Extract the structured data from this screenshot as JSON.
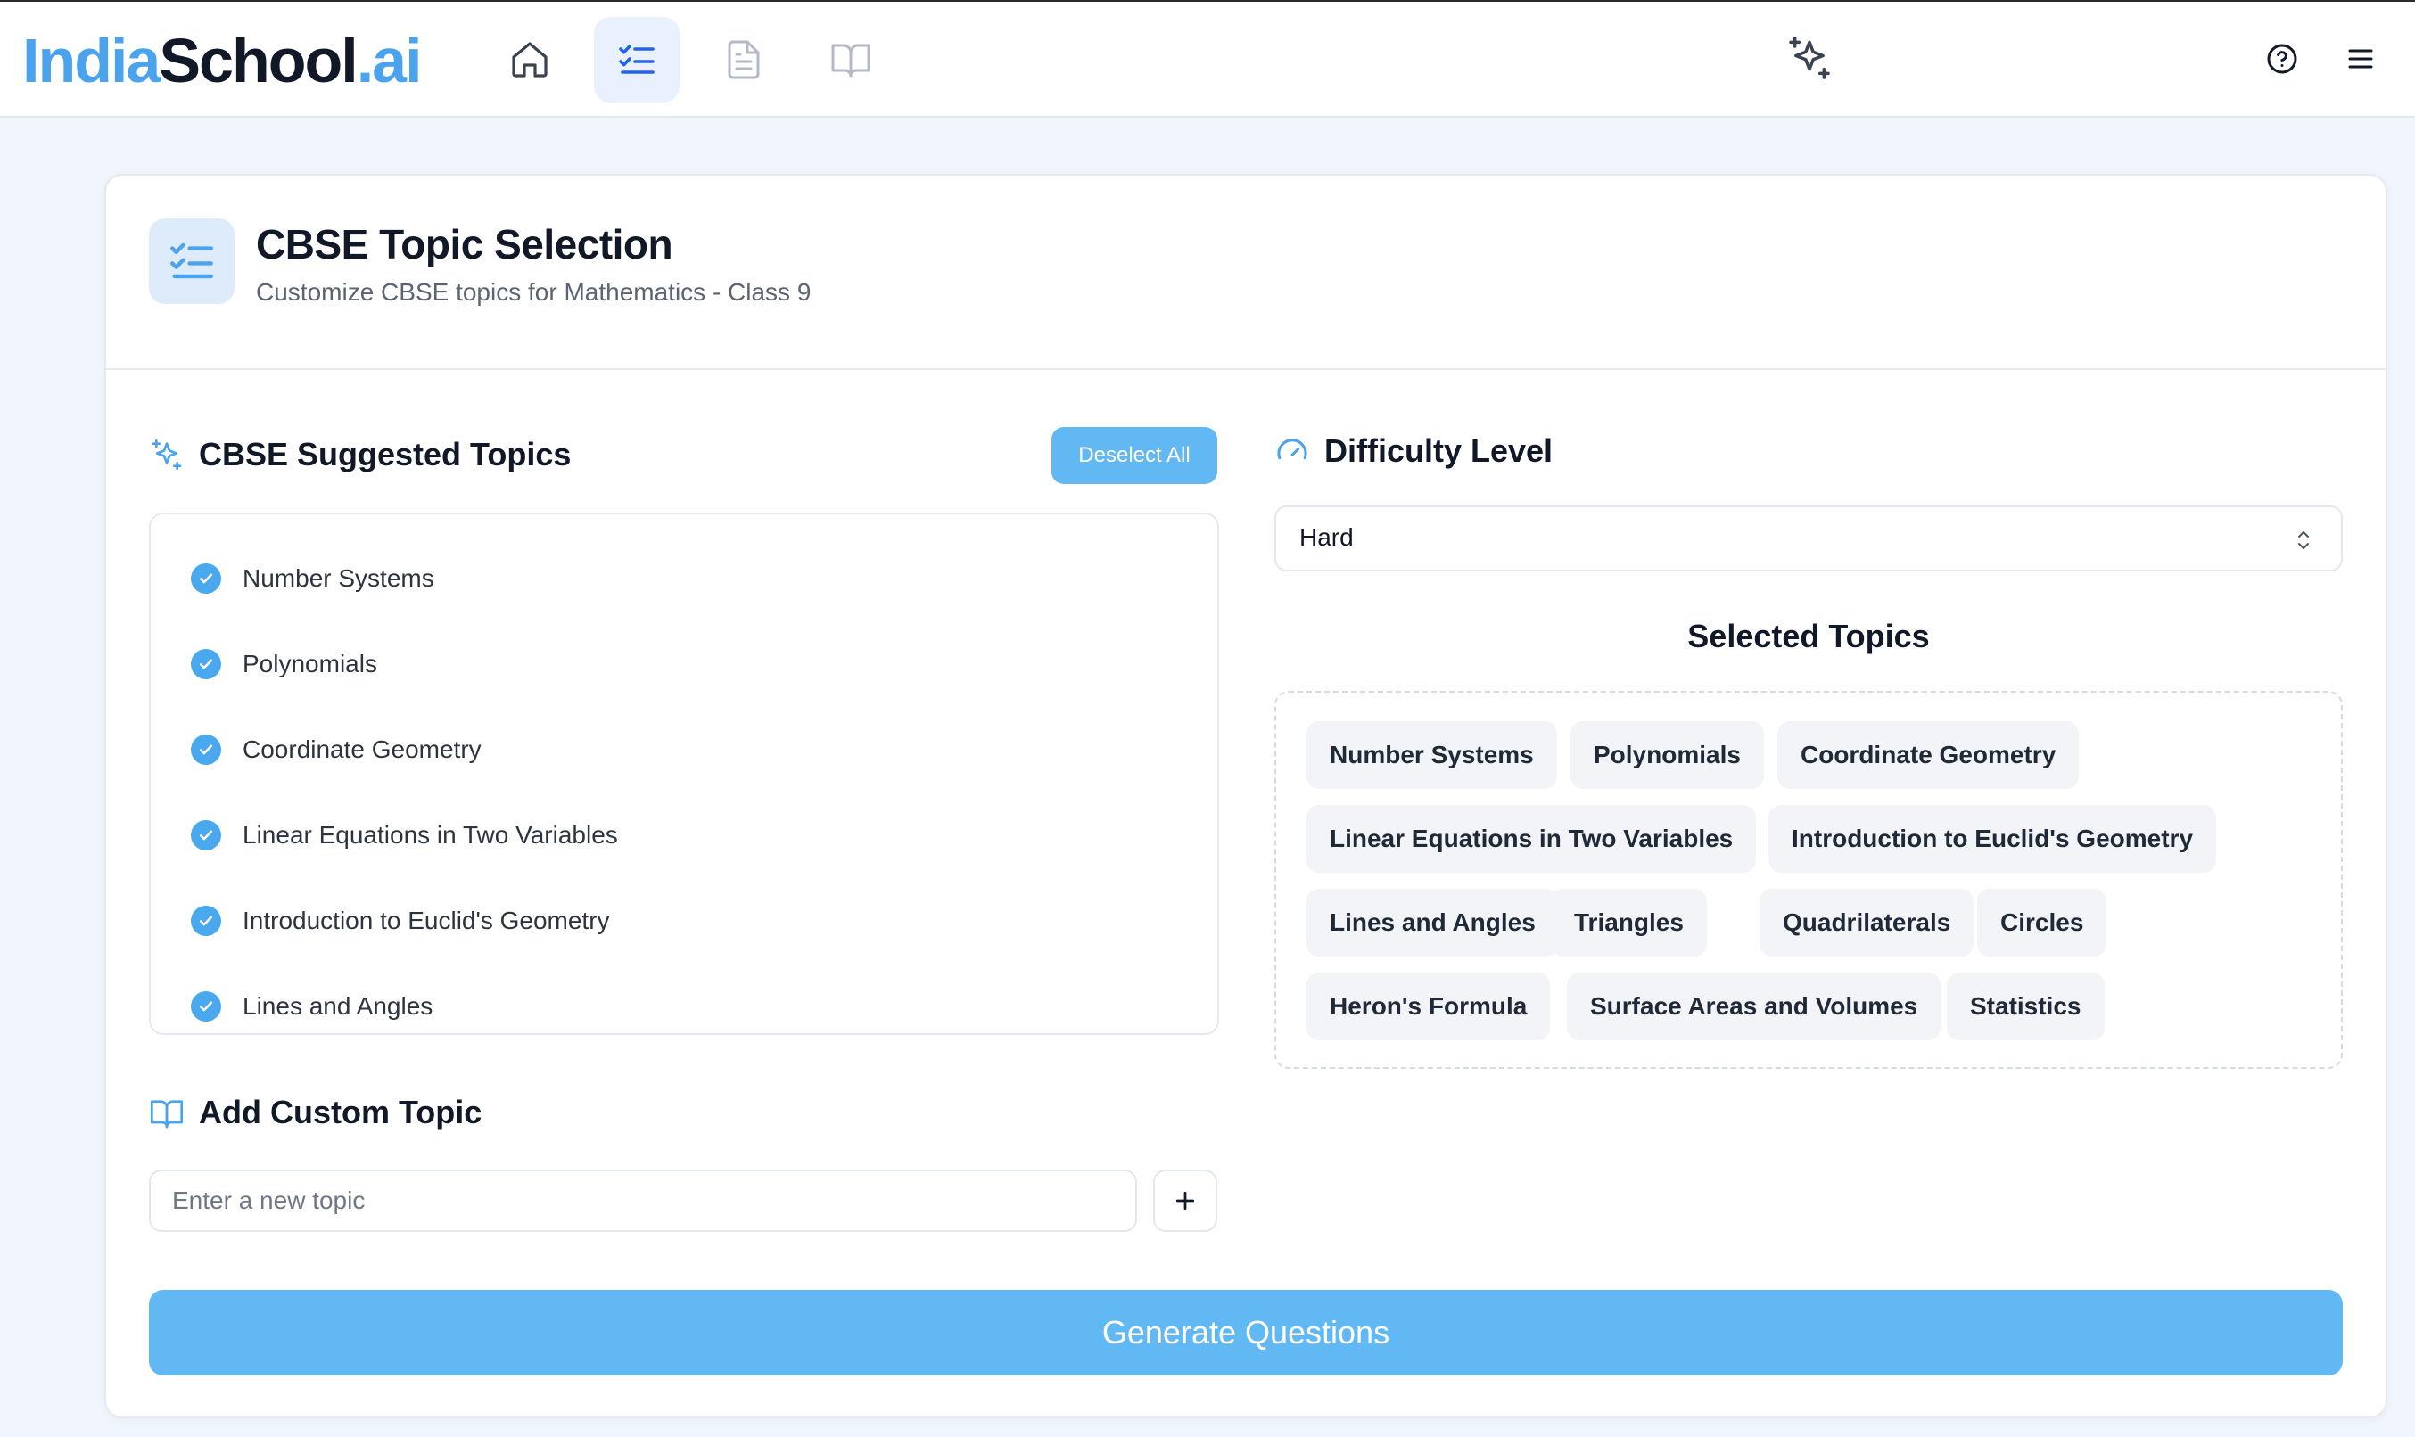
{
  "app": {
    "logo_part1": "India",
    "logo_part2": "School",
    "logo_part3": ".ai"
  },
  "nav": {
    "items": [
      {
        "icon": "home-icon"
      },
      {
        "icon": "checklist-icon",
        "active": true
      },
      {
        "icon": "document-icon"
      },
      {
        "icon": "book-icon"
      }
    ],
    "right_icons": [
      "sparkles-icon",
      "help-icon",
      "menu-icon"
    ]
  },
  "header": {
    "title": "CBSE Topic Selection",
    "subtitle": "Customize CBSE topics for Mathematics - Class 9"
  },
  "suggested": {
    "title": "CBSE Suggested Topics",
    "deselect_label": "Deselect All",
    "topics": [
      "Number Systems",
      "Polynomials",
      "Coordinate Geometry",
      "Linear Equations in Two Variables",
      "Introduction to Euclid's Geometry",
      "Lines and Angles"
    ]
  },
  "custom": {
    "title": "Add Custom Topic",
    "placeholder": "Enter a new topic",
    "value": ""
  },
  "difficulty": {
    "title": "Difficulty Level",
    "selected": "Hard"
  },
  "selected_topics": {
    "title": "Selected Topics",
    "items": [
      "Number Systems",
      "Polynomials",
      "Coordinate Geometry",
      "Linear Equations in Two Variables",
      "Introduction to Euclid's Geometry",
      "Lines and Angles",
      "Triangles",
      "Quadrilaterals",
      "Circles",
      "Heron's Formula",
      "Surface Areas and Volumes",
      "Statistics"
    ]
  },
  "generate_label": "Generate Questions",
  "colors": {
    "accent": "#4aa3ec",
    "button": "#62b8f3",
    "background": "#f1f6fd"
  }
}
